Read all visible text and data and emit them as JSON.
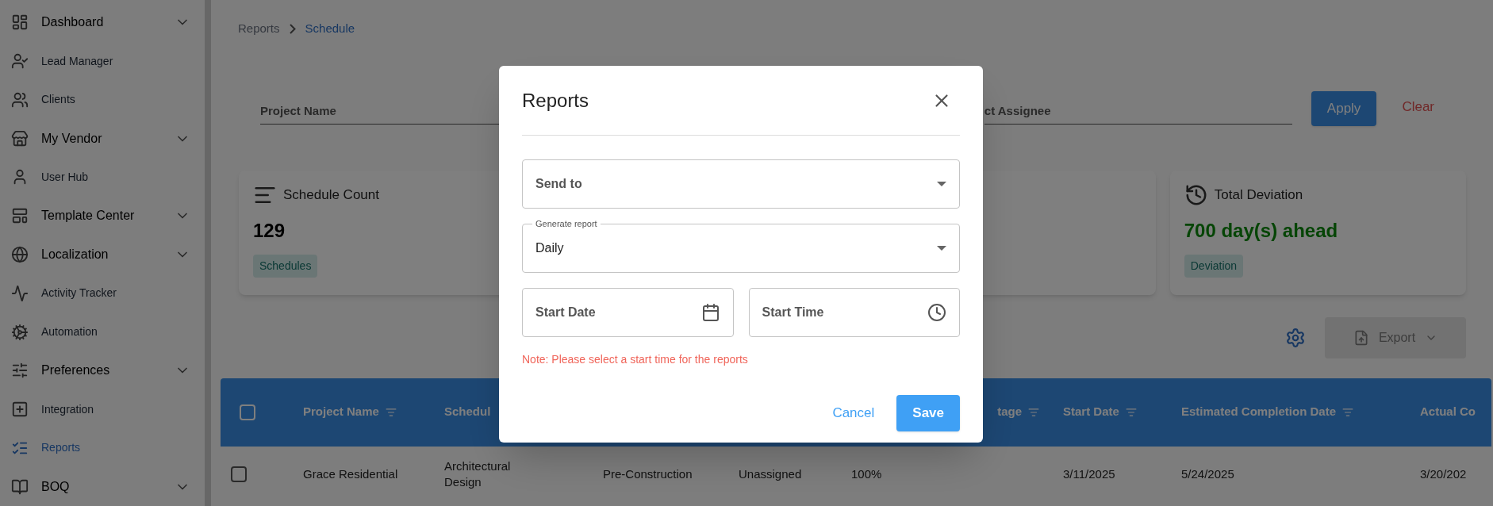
{
  "sidebar": {
    "items": [
      {
        "label": "Dashboard",
        "expandable": true,
        "selected": false
      },
      {
        "label": "Lead Manager",
        "expandable": false,
        "selected": false
      },
      {
        "label": "Clients",
        "expandable": false,
        "selected": false
      },
      {
        "label": "My Vendor",
        "expandable": true,
        "selected": false
      },
      {
        "label": "User Hub",
        "expandable": false,
        "selected": false
      },
      {
        "label": "Template Center",
        "expandable": true,
        "selected": false
      },
      {
        "label": "Localization",
        "expandable": true,
        "selected": false
      },
      {
        "label": "Activity Tracker",
        "expandable": false,
        "selected": false
      },
      {
        "label": "Automation",
        "expandable": false,
        "selected": false
      },
      {
        "label": "Preferences",
        "expandable": true,
        "selected": false
      },
      {
        "label": "Integration",
        "expandable": false,
        "selected": false
      },
      {
        "label": "Reports",
        "expandable": false,
        "selected": true
      },
      {
        "label": "BOQ",
        "expandable": true,
        "selected": false
      }
    ]
  },
  "breadcrumb": [
    "Reports",
    "Schedule"
  ],
  "filters": {
    "fields": [
      {
        "placeholder": "Project Name"
      },
      {
        "placeholder": "ct Assignee"
      }
    ],
    "apply": "Apply",
    "clear": "Clear"
  },
  "cards": [
    {
      "kind": "count",
      "title": "Schedule Count",
      "value": "129",
      "tag": "Schedules"
    },
    {
      "kind": "deviation",
      "title": "Total Deviation",
      "value": "700 day(s) ahead",
      "tag": "Deviation"
    }
  ],
  "toolbar": {
    "export": "Export",
    "disabled": true
  },
  "table": {
    "all_checked": false,
    "columns": [
      {
        "label": "Project Name",
        "sortable": true
      },
      {
        "label": "Schedul",
        "sortable": false
      },
      {},
      {},
      {
        "label": "tage",
        "sortable": true
      },
      {
        "label": "Start Date",
        "sortable": true
      },
      {
        "label": "Estimated Completion Date",
        "sortable": true
      },
      {
        "label": "Actual Co",
        "sortable": false
      }
    ],
    "rows": [
      {
        "checked": false,
        "cells": [
          "Grace Residential",
          "Architectural Design",
          "Pre-Construction",
          "Unassigned",
          "100%",
          "3/11/2025",
          "5/24/2025",
          "3/20/202"
        ]
      }
    ]
  },
  "dialog": {
    "title": "Reports",
    "fields": [
      {
        "kind": "select",
        "placeholder": "Send to"
      },
      {
        "kind": "select",
        "label": "Generate report",
        "value": "Daily"
      },
      {
        "kind": "date",
        "placeholder": "Start Date"
      },
      {
        "kind": "time",
        "placeholder": "Start Time"
      }
    ],
    "note": "Note: Please select a start time for the reports",
    "cancel": "Cancel",
    "save": "Save"
  }
}
